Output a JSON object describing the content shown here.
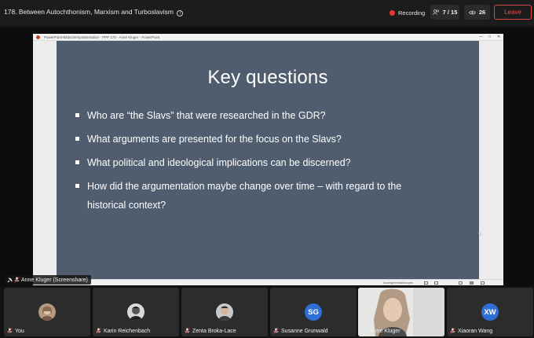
{
  "meeting": {
    "title": "178. Between Autochthonism, Marxism and Turboslavism",
    "info_icon": "i",
    "recording_label": "Recording",
    "participants_count": "7 / 15",
    "views_count": "26",
    "leave_label": "Leave"
  },
  "powerpoint": {
    "window_title": "PowerPoint-Bildschirmpräsentation  -  PPP 178 - Anne Kluger - PowerPoint",
    "status_label": "Anzeigeeinstellungen",
    "slide": {
      "title": "Key questions",
      "bullets": [
        "Who are “the Slavs” that were researched in the GDR?",
        "What arguments are presented for the focus on the Slavs?",
        "What political and ideological implications can be discerned?",
        "How did the argumentation maybe change over time – with regard to the",
        "historical context?"
      ]
    }
  },
  "presenter": {
    "label": "Anne Kluger (Screenshare)"
  },
  "participants": [
    {
      "name": "You",
      "avatar": "photo",
      "icon": "mic-muted-icon"
    },
    {
      "name": "Karin Reichenbach",
      "avatar": "photo",
      "icon": "mic-muted-icon"
    },
    {
      "name": "Zenta Broka-Lace",
      "avatar": "photo",
      "icon": "mic-muted-icon"
    },
    {
      "name": "Susanne Grunwald",
      "avatar": "SG",
      "icon": "mic-muted-icon"
    },
    {
      "name": "Anne Kluger",
      "avatar": "camera",
      "icon": "more-icon"
    },
    {
      "name": "Xiaoran Wang",
      "avatar": "XW",
      "icon": "mic-muted-icon"
    }
  ],
  "colors": {
    "slide_bg": "#4f5d6f",
    "leave": "#e5524c",
    "recording": "#e5372f",
    "initials_avatar": "#2f6fd8"
  }
}
